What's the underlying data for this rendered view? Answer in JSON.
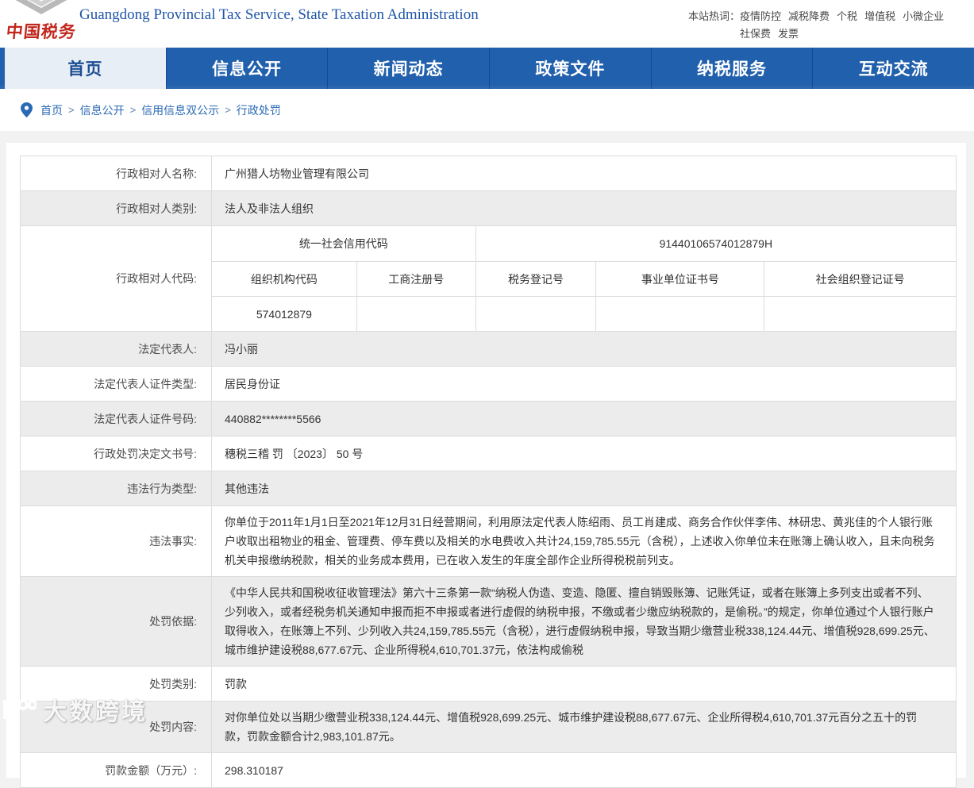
{
  "header": {
    "logo_text": "中国税务",
    "site_title_en": "Guangdong Provincial Tax Service, State Taxation Administration",
    "hotwords": {
      "label": "本站热词：",
      "items": [
        "疫情防控",
        "减税降费",
        "个税",
        "增值税",
        "小微企业",
        "社保费",
        "发票"
      ]
    }
  },
  "nav": {
    "tabs": [
      {
        "label": "首页",
        "active": true
      },
      {
        "label": "信息公开",
        "active": false
      },
      {
        "label": "新闻动态",
        "active": false
      },
      {
        "label": "政策文件",
        "active": false
      },
      {
        "label": "纳税服务",
        "active": false
      },
      {
        "label": "互动交流",
        "active": false
      }
    ]
  },
  "breadcrumb": {
    "separator": ">",
    "items": [
      "首页",
      "信息公开",
      "信用信息双公示",
      "行政处罚"
    ]
  },
  "table": {
    "rows": [
      {
        "label": "行政相对人名称:",
        "value": "广州猎人坊物业管理有限公司"
      },
      {
        "label": "行政相对人类别:",
        "value": "法人及非法人组织"
      },
      {
        "label": "法定代表人:",
        "value": "冯小丽"
      },
      {
        "label": "法定代表人证件类型:",
        "value": "居民身份证"
      },
      {
        "label": "法定代表人证件号码:",
        "value": "440882********5566"
      },
      {
        "label": "行政处罚决定文书号:",
        "value": "穗税三稽 罚 〔2023〕 50 号"
      },
      {
        "label": "违法行为类型:",
        "value": "其他违法"
      },
      {
        "label": "违法事实:",
        "value": "你单位于2011年1月1日至2021年12月31日经营期间，利用原法定代表人陈绍雨、员工肖建成、商务合作伙伴李伟、林研忠、黄兆佳的个人银行账户收取出租物业的租金、管理费、停车费以及相关的水电费收入共计24,159,785.55元（含税），上述收入你单位未在账簿上确认收入，且未向税务机关申报缴纳税款，相关的业务成本费用，已在收入发生的年度全部作企业所得税税前列支。"
      },
      {
        "label": "处罚依据:",
        "value": "《中华人民共和国税收征收管理法》第六十三条第一款“纳税人伪造、变造、隐匿、擅自销毁账簿、记账凭证，或者在账簿上多列支出或者不列、少列收入，或者经税务机关通知申报而拒不申报或者进行虚假的纳税申报，不缴或者少缴应纳税款的，是偷税。”的规定，你单位通过个人银行账户取得收入，在账簿上不列、少列收入共24,159,785.55元（含税），进行虚假纳税申报，导致当期少缴营业税338,124.44元、增值税928,699.25元、城市维护建设税88,677.67元、企业所得税4,610,701.37元，依法构成偷税"
      },
      {
        "label": "处罚类别:",
        "value": "罚款"
      },
      {
        "label": "处罚内容:",
        "value": "对你单位处以当期少缴营业税338,124.44元、增值税928,699.25元、城市维护建设税88,677.67元、企业所得税4,610,701.37元百分之五十的罚款，罚款金额合计2,983,101.87元。"
      },
      {
        "label": "罚款金额（万元）:",
        "value": "298.310187"
      }
    ],
    "code_section": {
      "label": "行政相对人代码:",
      "credit_code_label": "统一社会信用代码",
      "credit_code_value": "91440106574012879H",
      "col_headers": [
        "组织机构代码",
        "工商注册号",
        "税务登记号",
        "事业单位证书号",
        "社会组织登记证号"
      ],
      "col_values": [
        "574012879",
        "",
        "",
        "",
        ""
      ]
    }
  },
  "watermark": {
    "text": "大数跨境"
  },
  "colors": {
    "nav_blue": "#2160ac",
    "active_tab_bg": "#e8eef5",
    "active_tab_text": "#1d4f94",
    "title_blue": "#1e55a8",
    "breadcrumb_blue": "#2a6ab5",
    "row_gray": "#ececec",
    "table_border": "#dcdcdc",
    "logo_red": "#c2271e"
  }
}
